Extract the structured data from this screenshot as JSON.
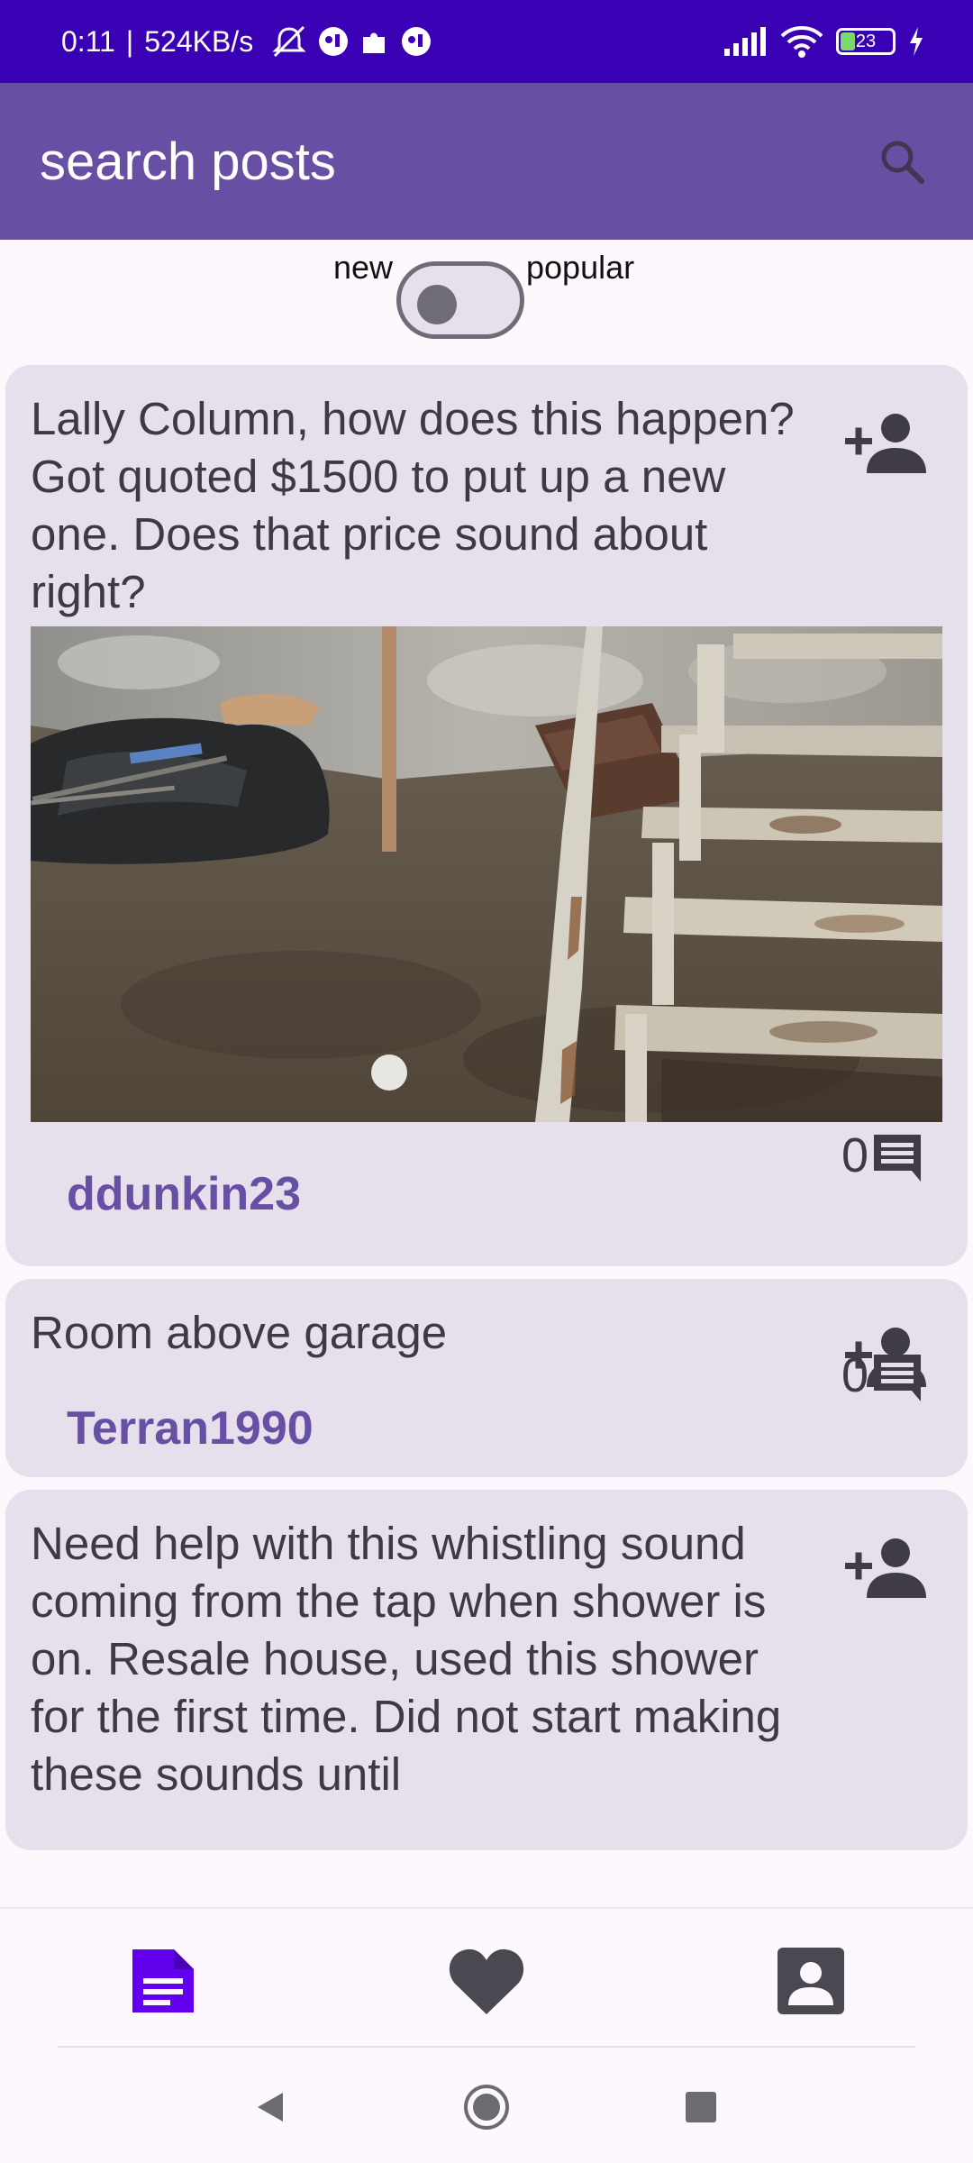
{
  "status_bar": {
    "time": "0:11",
    "network_speed": "524KB/s",
    "battery_level": "23",
    "icons": [
      "mute-icon",
      "app-icon",
      "puzzle-icon",
      "app-icon",
      "signal-icon",
      "wifi-icon",
      "battery-icon",
      "charging-icon"
    ]
  },
  "app_bar": {
    "search_placeholder": "search posts",
    "search_icon": "search-icon",
    "color": "#6750a4"
  },
  "sort_toggle": {
    "left_label": "new",
    "right_label": "popular",
    "state": "new"
  },
  "posts": [
    {
      "title": "Lally Column, how does this happen? Got quoted $1500 to put up a new one. Does that price sound about right?",
      "username": "ddunkin23",
      "comment_count": "0",
      "has_image": true
    },
    {
      "title": "Room above garage",
      "username": "Terran1990",
      "comment_count": "0",
      "has_image": false
    },
    {
      "title": "Need help with this whistling sound coming from the tap when shower is on. Resale house, used this shower for the first time. Did not start making these sounds until",
      "has_image": false
    }
  ],
  "bottom_nav": {
    "items": [
      {
        "icon": "posts-icon",
        "active": true
      },
      {
        "icon": "heart-icon",
        "active": false
      },
      {
        "icon": "profile-icon",
        "active": false
      }
    ],
    "active_color": "#6200ee",
    "inactive_color": "#4a4850"
  },
  "system_nav": {
    "icons": [
      "back-icon",
      "home-icon",
      "recents-icon"
    ]
  }
}
